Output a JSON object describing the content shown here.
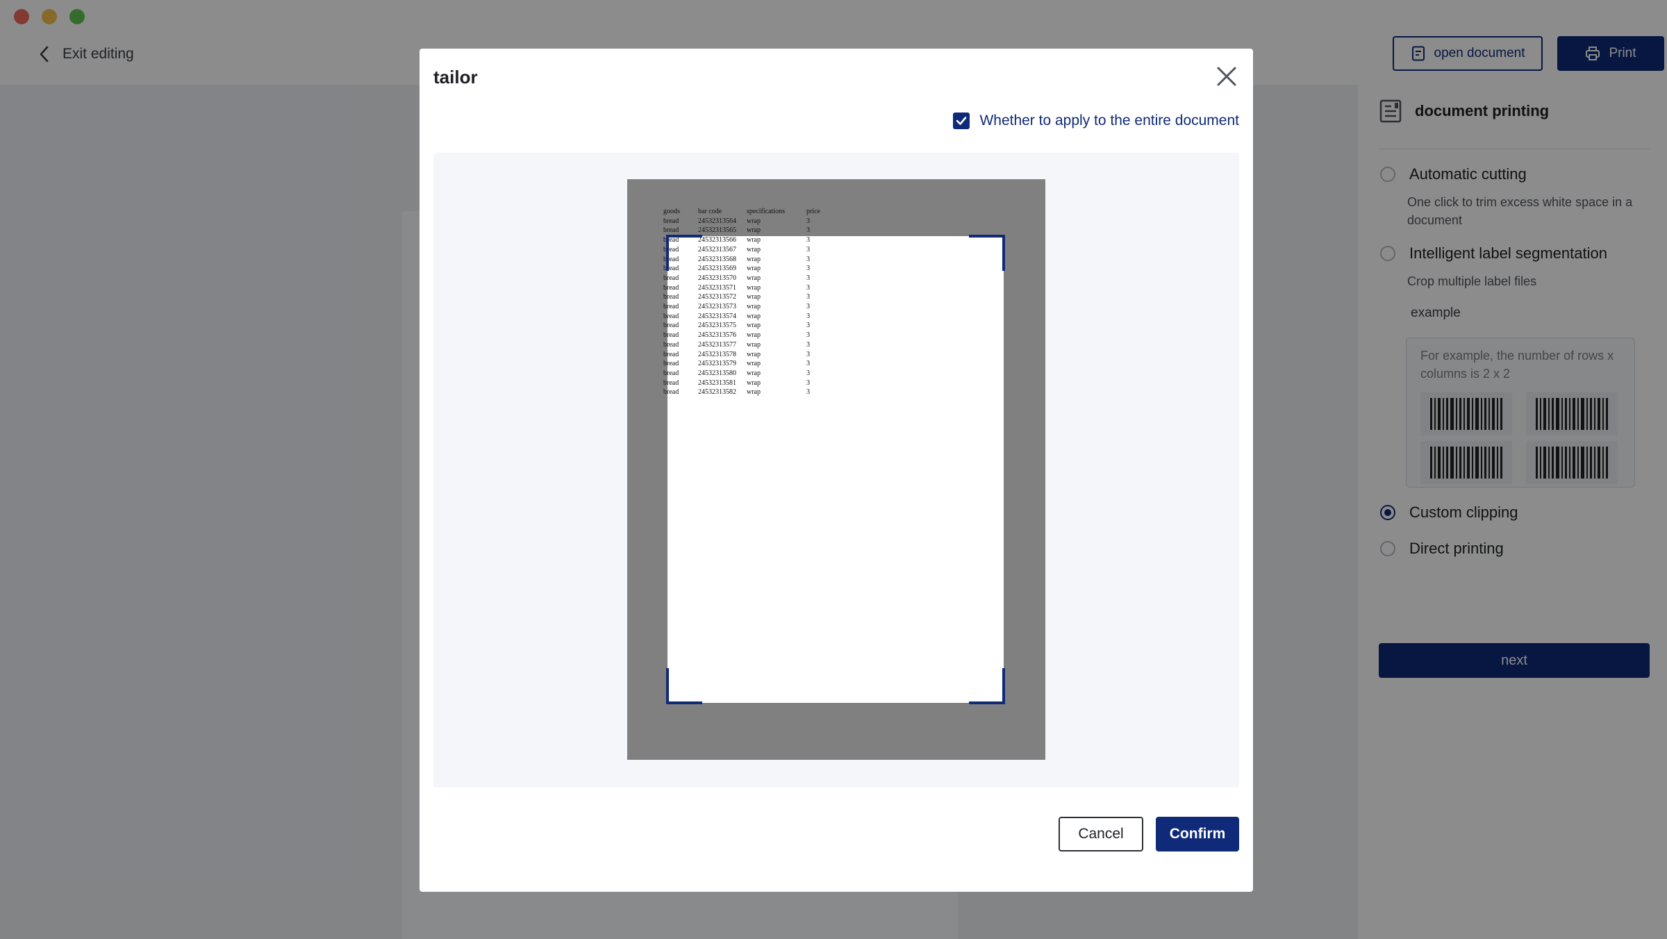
{
  "header": {
    "back_label": "Exit editing",
    "open_document_label": "open document",
    "print_label": "Print"
  },
  "side_panel": {
    "title": "document printing",
    "options": [
      {
        "label": "Automatic cutting",
        "description": "One click to trim excess white space in a document",
        "selected": false
      },
      {
        "label": "Intelligent label segmentation",
        "description": "Crop multiple label files",
        "selected": false
      },
      {
        "label": "Custom clipping",
        "selected": true
      },
      {
        "label": "Direct printing",
        "selected": false
      }
    ],
    "example_label": "example",
    "example_text": "For example, the number of rows x columns is 2 x 2",
    "next_label": "next"
  },
  "dialog": {
    "title": "tailor",
    "apply_all_label": "Whether to apply to the entire document",
    "apply_all_checked": true,
    "cancel_label": "Cancel",
    "confirm_label": "Confirm",
    "document": {
      "headers": [
        "goods",
        "bar code",
        "specifications",
        "price"
      ],
      "rows": [
        [
          "bread",
          "24532313564",
          "wrap",
          "3"
        ],
        [
          "bread",
          "24532313565",
          "wrap",
          "3"
        ],
        [
          "bread",
          "24532313566",
          "wrap",
          "3"
        ],
        [
          "bread",
          "24532313567",
          "wrap",
          "3"
        ],
        [
          "bread",
          "24532313568",
          "wrap",
          "3"
        ],
        [
          "bread",
          "24532313569",
          "wrap",
          "3"
        ],
        [
          "bread",
          "24532313570",
          "wrap",
          "3"
        ],
        [
          "bread",
          "24532313571",
          "wrap",
          "3"
        ],
        [
          "bread",
          "24532313572",
          "wrap",
          "3"
        ],
        [
          "bread",
          "24532313573",
          "wrap",
          "3"
        ],
        [
          "bread",
          "24532313574",
          "wrap",
          "3"
        ],
        [
          "bread",
          "24532313575",
          "wrap",
          "3"
        ],
        [
          "bread",
          "24532313576",
          "wrap",
          "3"
        ],
        [
          "bread",
          "24532313577",
          "wrap",
          "3"
        ],
        [
          "bread",
          "24532313578",
          "wrap",
          "3"
        ],
        [
          "bread",
          "24532313579",
          "wrap",
          "3"
        ],
        [
          "bread",
          "24532313580",
          "wrap",
          "3"
        ],
        [
          "bread",
          "24532313581",
          "wrap",
          "3"
        ],
        [
          "bread",
          "24532313582",
          "wrap",
          "3"
        ]
      ]
    }
  },
  "colors": {
    "primary": "#0f2a78",
    "overlay": "rgba(0,0,0,0.45)",
    "canvas": "#808080"
  }
}
